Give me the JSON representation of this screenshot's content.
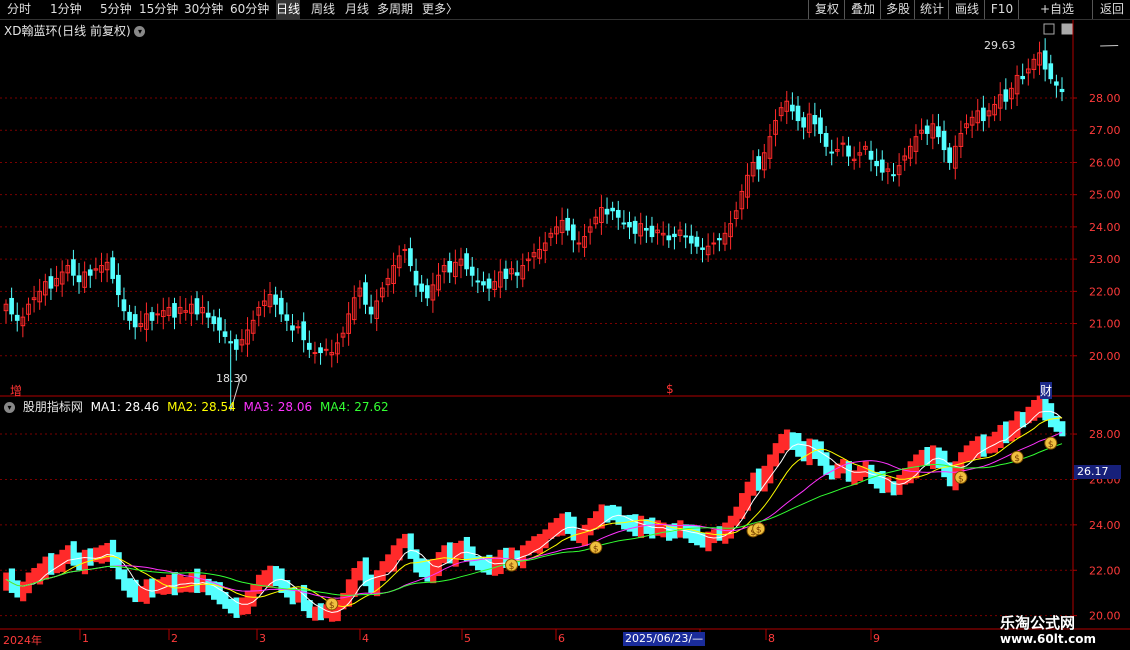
{
  "toolbar": {
    "periods": [
      "分时",
      "1分钟",
      "5分钟",
      "15分钟",
      "30分钟",
      "60分钟",
      "日线",
      "周线",
      "月线",
      "多周期",
      "更多"
    ],
    "active": "日线",
    "more_arrow": "〉",
    "buttons": [
      "复权",
      "叠加",
      "多股",
      "统计",
      "画线",
      "F10",
      "+自选",
      "返回"
    ]
  },
  "stock": {
    "title": "XD翰蓝环(日线 前复权)",
    "dropdown_icon": "chevron-down-icon"
  },
  "main_chart": {
    "high_label": "29.63",
    "low_label": "18.30",
    "tag_left": "增",
    "tag_right": "财",
    "tag_dollar": "$"
  },
  "indicator": {
    "name": "股朋指标网",
    "ma": [
      {
        "label": "MA1:",
        "value": "28.46",
        "color": "#ffffff"
      },
      {
        "label": "MA2:",
        "value": "28.54",
        "color": "#ffff00"
      },
      {
        "label": "MA3:",
        "value": "28.06",
        "color": "#ff33ff"
      },
      {
        "label": "MA4:",
        "value": "27.62",
        "color": "#33ff33"
      }
    ],
    "current_value": "26.17"
  },
  "date_axis": {
    "labels": [
      "2024年",
      "1",
      "2",
      "3",
      "4",
      "5",
      "6",
      "7",
      "8",
      "9"
    ],
    "selected_date": "2025/06/23/—"
  },
  "watermark": {
    "name": "乐淘公式网",
    "url": "www.60lt.com"
  },
  "colors": {
    "up": "#ff2a2a",
    "down": "#54ffff",
    "grid": "#7a0000",
    "axis": "#b00000"
  },
  "chart_data": {
    "type": "candlestick",
    "y_axis_main": [
      28.0,
      27.0,
      26.0,
      25.0,
      24.0,
      23.0,
      22.0,
      21.0,
      20.0
    ],
    "y_axis_indicator": [
      28.0,
      26.0,
      24.0,
      22.0,
      20.0
    ],
    "ylim": [
      18.3,
      29.63
    ],
    "x_labels": [
      "2024年",
      "1",
      "2",
      "3",
      "4",
      "5",
      "6",
      "7",
      "8",
      "9"
    ],
    "close": [
      21.6,
      21.3,
      21.1,
      21.2,
      21.6,
      21.8,
      22.0,
      22.3,
      22.1,
      22.4,
      22.6,
      22.8,
      22.5,
      22.3,
      22.6,
      22.5,
      22.7,
      22.8,
      22.9,
      22.4,
      21.9,
      21.4,
      21.1,
      20.9,
      21.0,
      21.3,
      21.1,
      21.3,
      21.4,
      21.5,
      21.2,
      21.5,
      21.4,
      21.6,
      21.3,
      21.5,
      21.2,
      21.0,
      20.8,
      20.6,
      20.4,
      20.2,
      20.5,
      20.8,
      21.1,
      21.5,
      21.7,
      21.9,
      21.6,
      21.3,
      21.1,
      20.8,
      20.9,
      20.5,
      20.2,
      20.1,
      20.1,
      20.2,
      20.1,
      20.4,
      20.7,
      21.3,
      21.8,
      22.1,
      21.6,
      21.3,
      21.7,
      22.1,
      22.4,
      22.8,
      23.1,
      23.3,
      22.8,
      22.2,
      22.0,
      21.8,
      22.2,
      22.5,
      22.8,
      22.6,
      22.9,
      23.0,
      22.7,
      22.5,
      22.3,
      22.2,
      22.1,
      22.3,
      22.6,
      22.4,
      22.7,
      22.5,
      22.8,
      23.0,
      23.2,
      23.3,
      23.5,
      23.8,
      24.0,
      24.2,
      23.9,
      23.6,
      23.5,
      23.7,
      24.0,
      24.3,
      24.6,
      24.4,
      24.5,
      24.3,
      24.1,
      24.0,
      23.8,
      24.1,
      23.9,
      23.7,
      23.9,
      23.8,
      23.6,
      23.7,
      23.9,
      23.7,
      23.5,
      23.4,
      23.3,
      23.4,
      23.5,
      23.6,
      23.8,
      24.1,
      24.5,
      25.1,
      25.6,
      26.0,
      25.8,
      26.3,
      26.8,
      27.3,
      27.7,
      27.9,
      27.6,
      27.3,
      27.1,
      27.5,
      27.2,
      26.9,
      26.5,
      26.3,
      26.4,
      26.6,
      26.2,
      26.1,
      26.3,
      26.5,
      26.1,
      25.9,
      25.7,
      25.8,
      25.6,
      25.9,
      26.2,
      26.5,
      26.8,
      27.0,
      26.9,
      27.2,
      26.8,
      26.4,
      26.0,
      26.5,
      26.9,
      27.2,
      27.4,
      27.6,
      27.3,
      27.6,
      27.8,
      28.1,
      27.9,
      28.3,
      28.7,
      28.6,
      28.9,
      29.2,
      29.4,
      28.9,
      28.6,
      28.4,
      28.2
    ]
  }
}
